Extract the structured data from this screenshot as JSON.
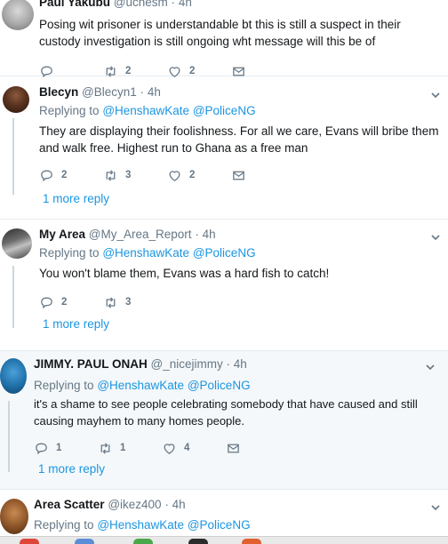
{
  "tweets": [
    {
      "name": "Paul Yakubu",
      "handle": "@uchesm",
      "time": "4h",
      "text": "Posing wit prisoner is understandable bt this is still a suspect in their custody investigation is still ongoing wht message will this be of",
      "reply": "",
      "retweets": "2",
      "likes": "2"
    },
    {
      "name": "Blecyn",
      "handle": "@Blecyn1",
      "time": "4h",
      "replying_prefix": "Replying to",
      "mention1": "@HenshawKate",
      "mention2": "@PoliceNG",
      "text": "They are displaying their foolishness. For all we care, Evans will bribe them and walk free. Highest run to Ghana as a free man",
      "reply": "2",
      "retweets": "3",
      "likes": "2",
      "more": "1 more reply"
    },
    {
      "name": "My Area",
      "handle": "@My_Area_Report",
      "time": "4h",
      "replying_prefix": "Replying to",
      "mention1": "@HenshawKate",
      "mention2": "@PoliceNG",
      "text": "You won't blame them, Evans was a hard fish to catch!",
      "reply": "2",
      "retweets": "3",
      "more": "1 more reply"
    },
    {
      "name": "JIMMY. PAUL ONAH",
      "handle": "@_nicejimmy",
      "time": "4h",
      "replying_prefix": "Replying to",
      "mention1": "@HenshawKate",
      "mention2": "@PoliceNG",
      "text": "it's a shame to see people celebrating somebody that have caused and still causing mayhem to many homes people.",
      "reply": "1",
      "retweets": "1",
      "likes": "4",
      "more": "1 more reply"
    },
    {
      "name": "Area Scatter",
      "handle": "@ikez400",
      "time": "4h",
      "replying_prefix": "Replying to",
      "mention1": "@HenshawKate",
      "mention2": "@PoliceNG"
    }
  ],
  "separator": "·",
  "icons": {
    "reply": "reply-icon",
    "retweet": "retweet-icon",
    "like": "heart-icon",
    "dm": "envelope-icon",
    "more": "chevron-down-icon"
  },
  "colors": {
    "link": "#1b95e0",
    "muted": "#657786",
    "highlight": "#f5f8fa"
  }
}
